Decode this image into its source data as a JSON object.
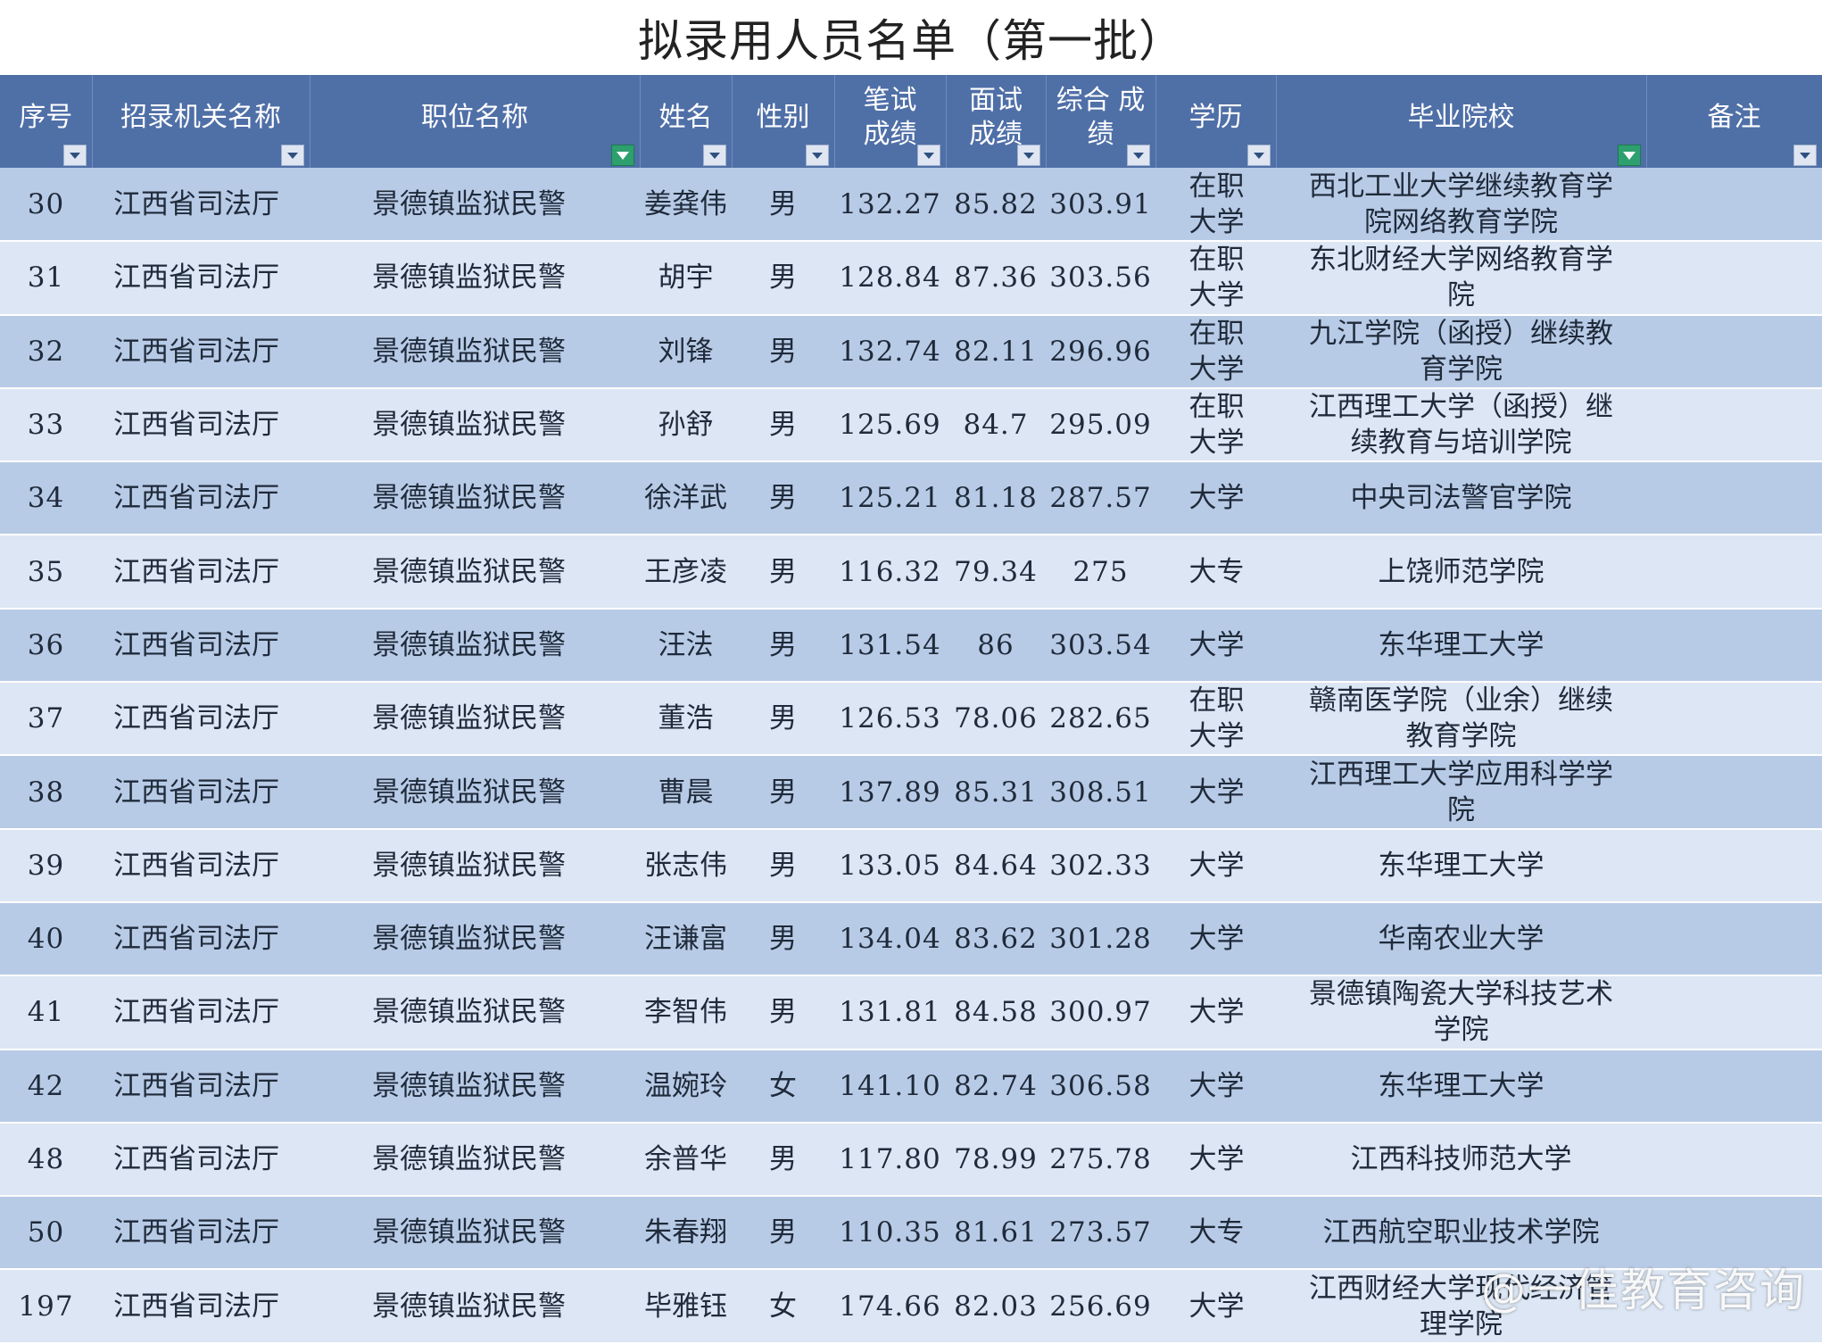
{
  "title": "拟录用人员名单（第一批）",
  "columns": [
    {
      "label": "序号",
      "filter": "dropdown"
    },
    {
      "label": "招录机关名称",
      "filter": "dropdown"
    },
    {
      "label": "职位名称",
      "filter": "active"
    },
    {
      "label": "姓名",
      "filter": "dropdown"
    },
    {
      "label": "性别",
      "filter": "dropdown"
    },
    {
      "label": "笔试\n成绩",
      "filter": "dropdown"
    },
    {
      "label": "面试\n成绩",
      "filter": "dropdown"
    },
    {
      "label": "综合 成\n绩",
      "filter": "dropdown"
    },
    {
      "label": "学历",
      "filter": "dropdown"
    },
    {
      "label": "毕业院校",
      "filter": "active"
    },
    {
      "label": "备注",
      "filter": "dropdown"
    }
  ],
  "rows": [
    [
      "30",
      "江西省司法厅",
      "景德镇监狱民警",
      "姜龚伟",
      "男",
      "132.27",
      "85.82",
      "303.91",
      "在职大学",
      "西北工业大学继续教育学院网络教育学院",
      ""
    ],
    [
      "31",
      "江西省司法厅",
      "景德镇监狱民警",
      "胡宇",
      "男",
      "128.84",
      "87.36",
      "303.56",
      "在职大学",
      "东北财经大学网络教育学院",
      ""
    ],
    [
      "32",
      "江西省司法厅",
      "景德镇监狱民警",
      "刘锋",
      "男",
      "132.74",
      "82.11",
      "296.96",
      "在职大学",
      "九江学院（函授）继续教育学院",
      ""
    ],
    [
      "33",
      "江西省司法厅",
      "景德镇监狱民警",
      "孙舒",
      "男",
      "125.69",
      "84.7",
      "295.09",
      "在职大学",
      "江西理工大学（函授）继续教育与培训学院",
      ""
    ],
    [
      "34",
      "江西省司法厅",
      "景德镇监狱民警",
      "徐洋武",
      "男",
      "125.21",
      "81.18",
      "287.57",
      "大学",
      "中央司法警官学院",
      ""
    ],
    [
      "35",
      "江西省司法厅",
      "景德镇监狱民警",
      "王彦凌",
      "男",
      "116.32",
      "79.34",
      "275",
      "大专",
      "上饶师范学院",
      ""
    ],
    [
      "36",
      "江西省司法厅",
      "景德镇监狱民警",
      "汪法",
      "男",
      "131.54",
      "86",
      "303.54",
      "大学",
      "东华理工大学",
      ""
    ],
    [
      "37",
      "江西省司法厅",
      "景德镇监狱民警",
      "董浩",
      "男",
      "126.53",
      "78.06",
      "282.65",
      "在职大学",
      "赣南医学院（业余）继续教育学院",
      ""
    ],
    [
      "38",
      "江西省司法厅",
      "景德镇监狱民警",
      "曹晨",
      "男",
      "137.89",
      "85.31",
      "308.51",
      "大学",
      "江西理工大学应用科学学院",
      ""
    ],
    [
      "39",
      "江西省司法厅",
      "景德镇监狱民警",
      "张志伟",
      "男",
      "133.05",
      "84.64",
      "302.33",
      "大学",
      "东华理工大学",
      ""
    ],
    [
      "40",
      "江西省司法厅",
      "景德镇监狱民警",
      "汪谦富",
      "男",
      "134.04",
      "83.62",
      "301.28",
      "大学",
      "华南农业大学",
      ""
    ],
    [
      "41",
      "江西省司法厅",
      "景德镇监狱民警",
      "李智伟",
      "男",
      "131.81",
      "84.58",
      "300.97",
      "大学",
      "景德镇陶瓷大学科技艺术学院",
      ""
    ],
    [
      "42",
      "江西省司法厅",
      "景德镇监狱民警",
      "温婉玲",
      "女",
      "141.10",
      "82.74",
      "306.58",
      "大学",
      "东华理工大学",
      ""
    ],
    [
      "48",
      "江西省司法厅",
      "景德镇监狱民警",
      "余普华",
      "男",
      "117.80",
      "78.99",
      "275.78",
      "大学",
      "江西科技师范大学",
      ""
    ],
    [
      "50",
      "江西省司法厅",
      "景德镇监狱民警",
      "朱春翔",
      "男",
      "110.35",
      "81.61",
      "273.57",
      "大专",
      "江西航空职业技术学院",
      ""
    ],
    [
      "197",
      "江西省司法厅",
      "景德镇监狱民警",
      "毕雅钰",
      "女",
      "174.66",
      "82.03",
      "256.69",
      "大学",
      "江西财经大学现代经济管理学院",
      ""
    ]
  ],
  "watermark": "@一佳教育咨询",
  "colors": {
    "header_bg": "#4f6fa7",
    "row_band": "#b8cbe6",
    "row_plain": "#dce6f4",
    "filter_active": "#2e9f6e"
  }
}
